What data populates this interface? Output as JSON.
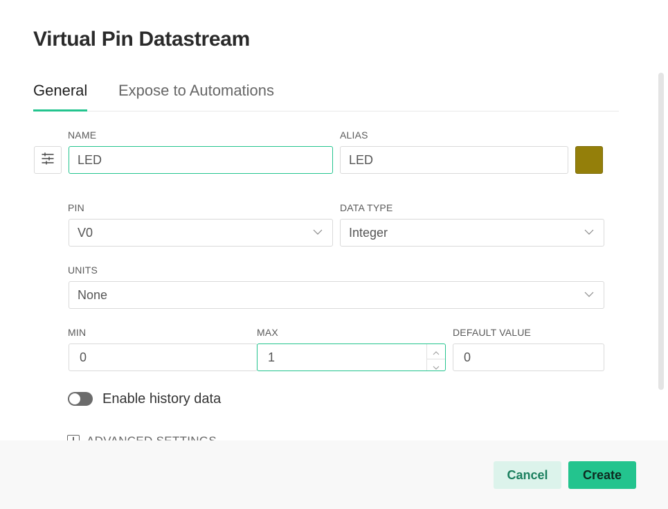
{
  "dialog": {
    "title": "Virtual Pin Datastream"
  },
  "tabs": [
    {
      "label": "General",
      "active": true
    },
    {
      "label": "Expose to Automations",
      "active": false
    }
  ],
  "form": {
    "name": {
      "label": "NAME",
      "value": "LED"
    },
    "alias": {
      "label": "ALIAS",
      "value": "LED"
    },
    "color": "#947f0a",
    "pin": {
      "label": "PIN",
      "value": "V0"
    },
    "data_type": {
      "label": "DATA TYPE",
      "value": "Integer"
    },
    "units": {
      "label": "UNITS",
      "value": "None"
    },
    "min": {
      "label": "MIN",
      "value": "0"
    },
    "max": {
      "label": "MAX",
      "value": "1"
    },
    "default_value": {
      "label": "DEFAULT VALUE",
      "value": "0"
    },
    "history": {
      "label": "Enable history data",
      "enabled": false
    },
    "advanced": {
      "label": "ADVANCED SETTINGS"
    }
  },
  "footer": {
    "cancel_label": "Cancel",
    "create_label": "Create"
  },
  "colors": {
    "accent": "#23c48e",
    "cancel_bg": "#dcf3eb"
  }
}
